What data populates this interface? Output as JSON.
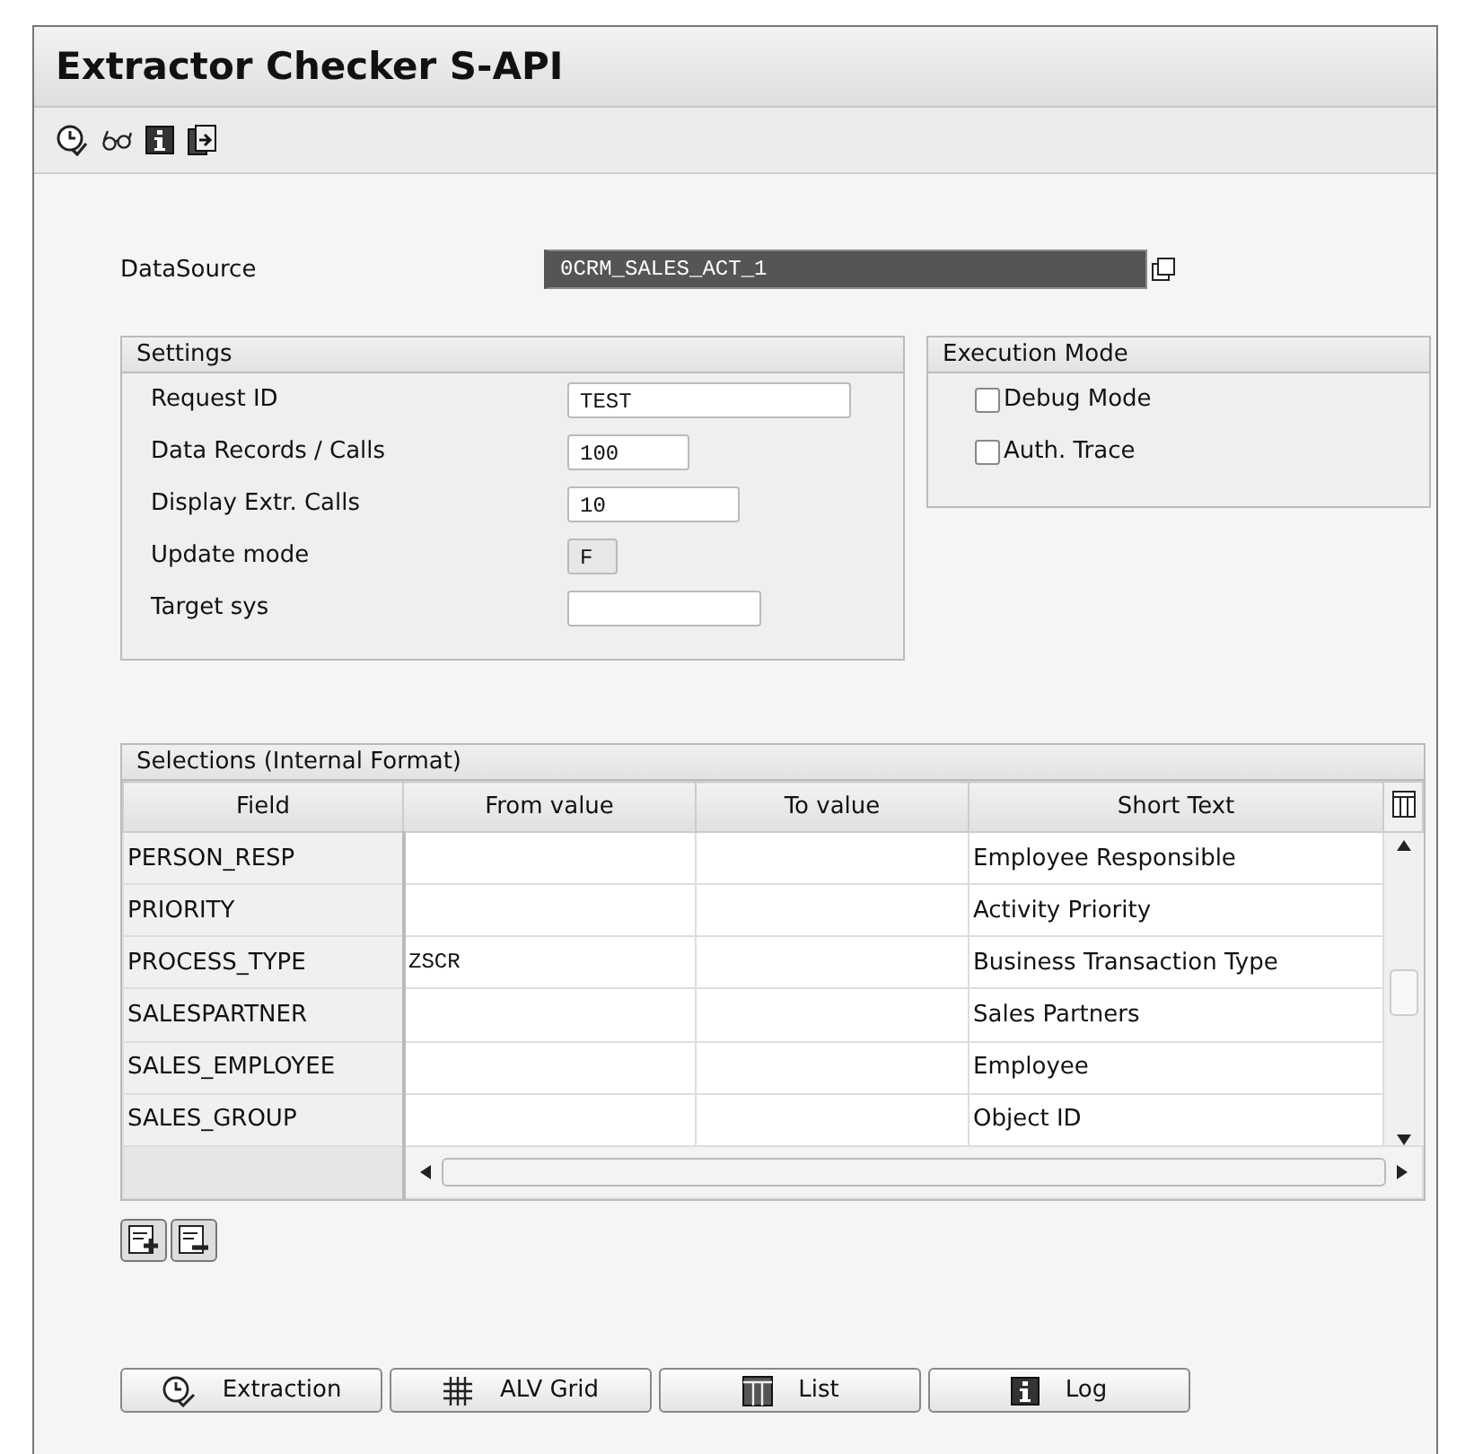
{
  "window": {
    "title": "Extractor Checker S-API"
  },
  "datasource": {
    "label": "DataSource",
    "value": "0CRM_SALES_ACT_1",
    "selected": true
  },
  "settings": {
    "title": "Settings",
    "fields": [
      {
        "label": "Request ID",
        "value": "TEST",
        "disabled": false
      },
      {
        "label": "Data Records / Calls",
        "value": "100",
        "disabled": false
      },
      {
        "label": "Display Extr. Calls",
        "value": "10",
        "disabled": false
      },
      {
        "label": "Update mode",
        "value": "F",
        "disabled": true
      },
      {
        "label": "Target sys",
        "disabled": false
      }
    ]
  },
  "execution_mode": {
    "title": "Execution Mode",
    "options": [
      {
        "label": "Debug Mode",
        "checked": false
      },
      {
        "label": "Auth. Trace",
        "checked": false
      }
    ]
  },
  "selections": {
    "title": "Selections (Internal Format)",
    "columns": [
      "Field",
      "From value",
      "To value",
      "Short Text"
    ],
    "rows": [
      [
        "PERSON_RESP",
        "",
        "",
        "Employee Responsible"
      ],
      [
        "PRIORITY",
        "",
        "",
        "Activity Priority"
      ],
      [
        "PROCESS_TYPE",
        "ZSCR",
        "",
        "Business Transaction Type"
      ],
      [
        "SALESPARTNER",
        "",
        "",
        "Sales Partners"
      ],
      [
        "SALES_EMPLOYEE",
        "",
        "",
        "Employee"
      ],
      [
        "SALES_GROUP",
        "",
        "",
        "Object ID"
      ]
    ]
  },
  "buttons": [
    {
      "label": "Extraction"
    },
    {
      "label": "ALV Grid"
    },
    {
      "label": "List"
    },
    {
      "label": "Log"
    }
  ]
}
